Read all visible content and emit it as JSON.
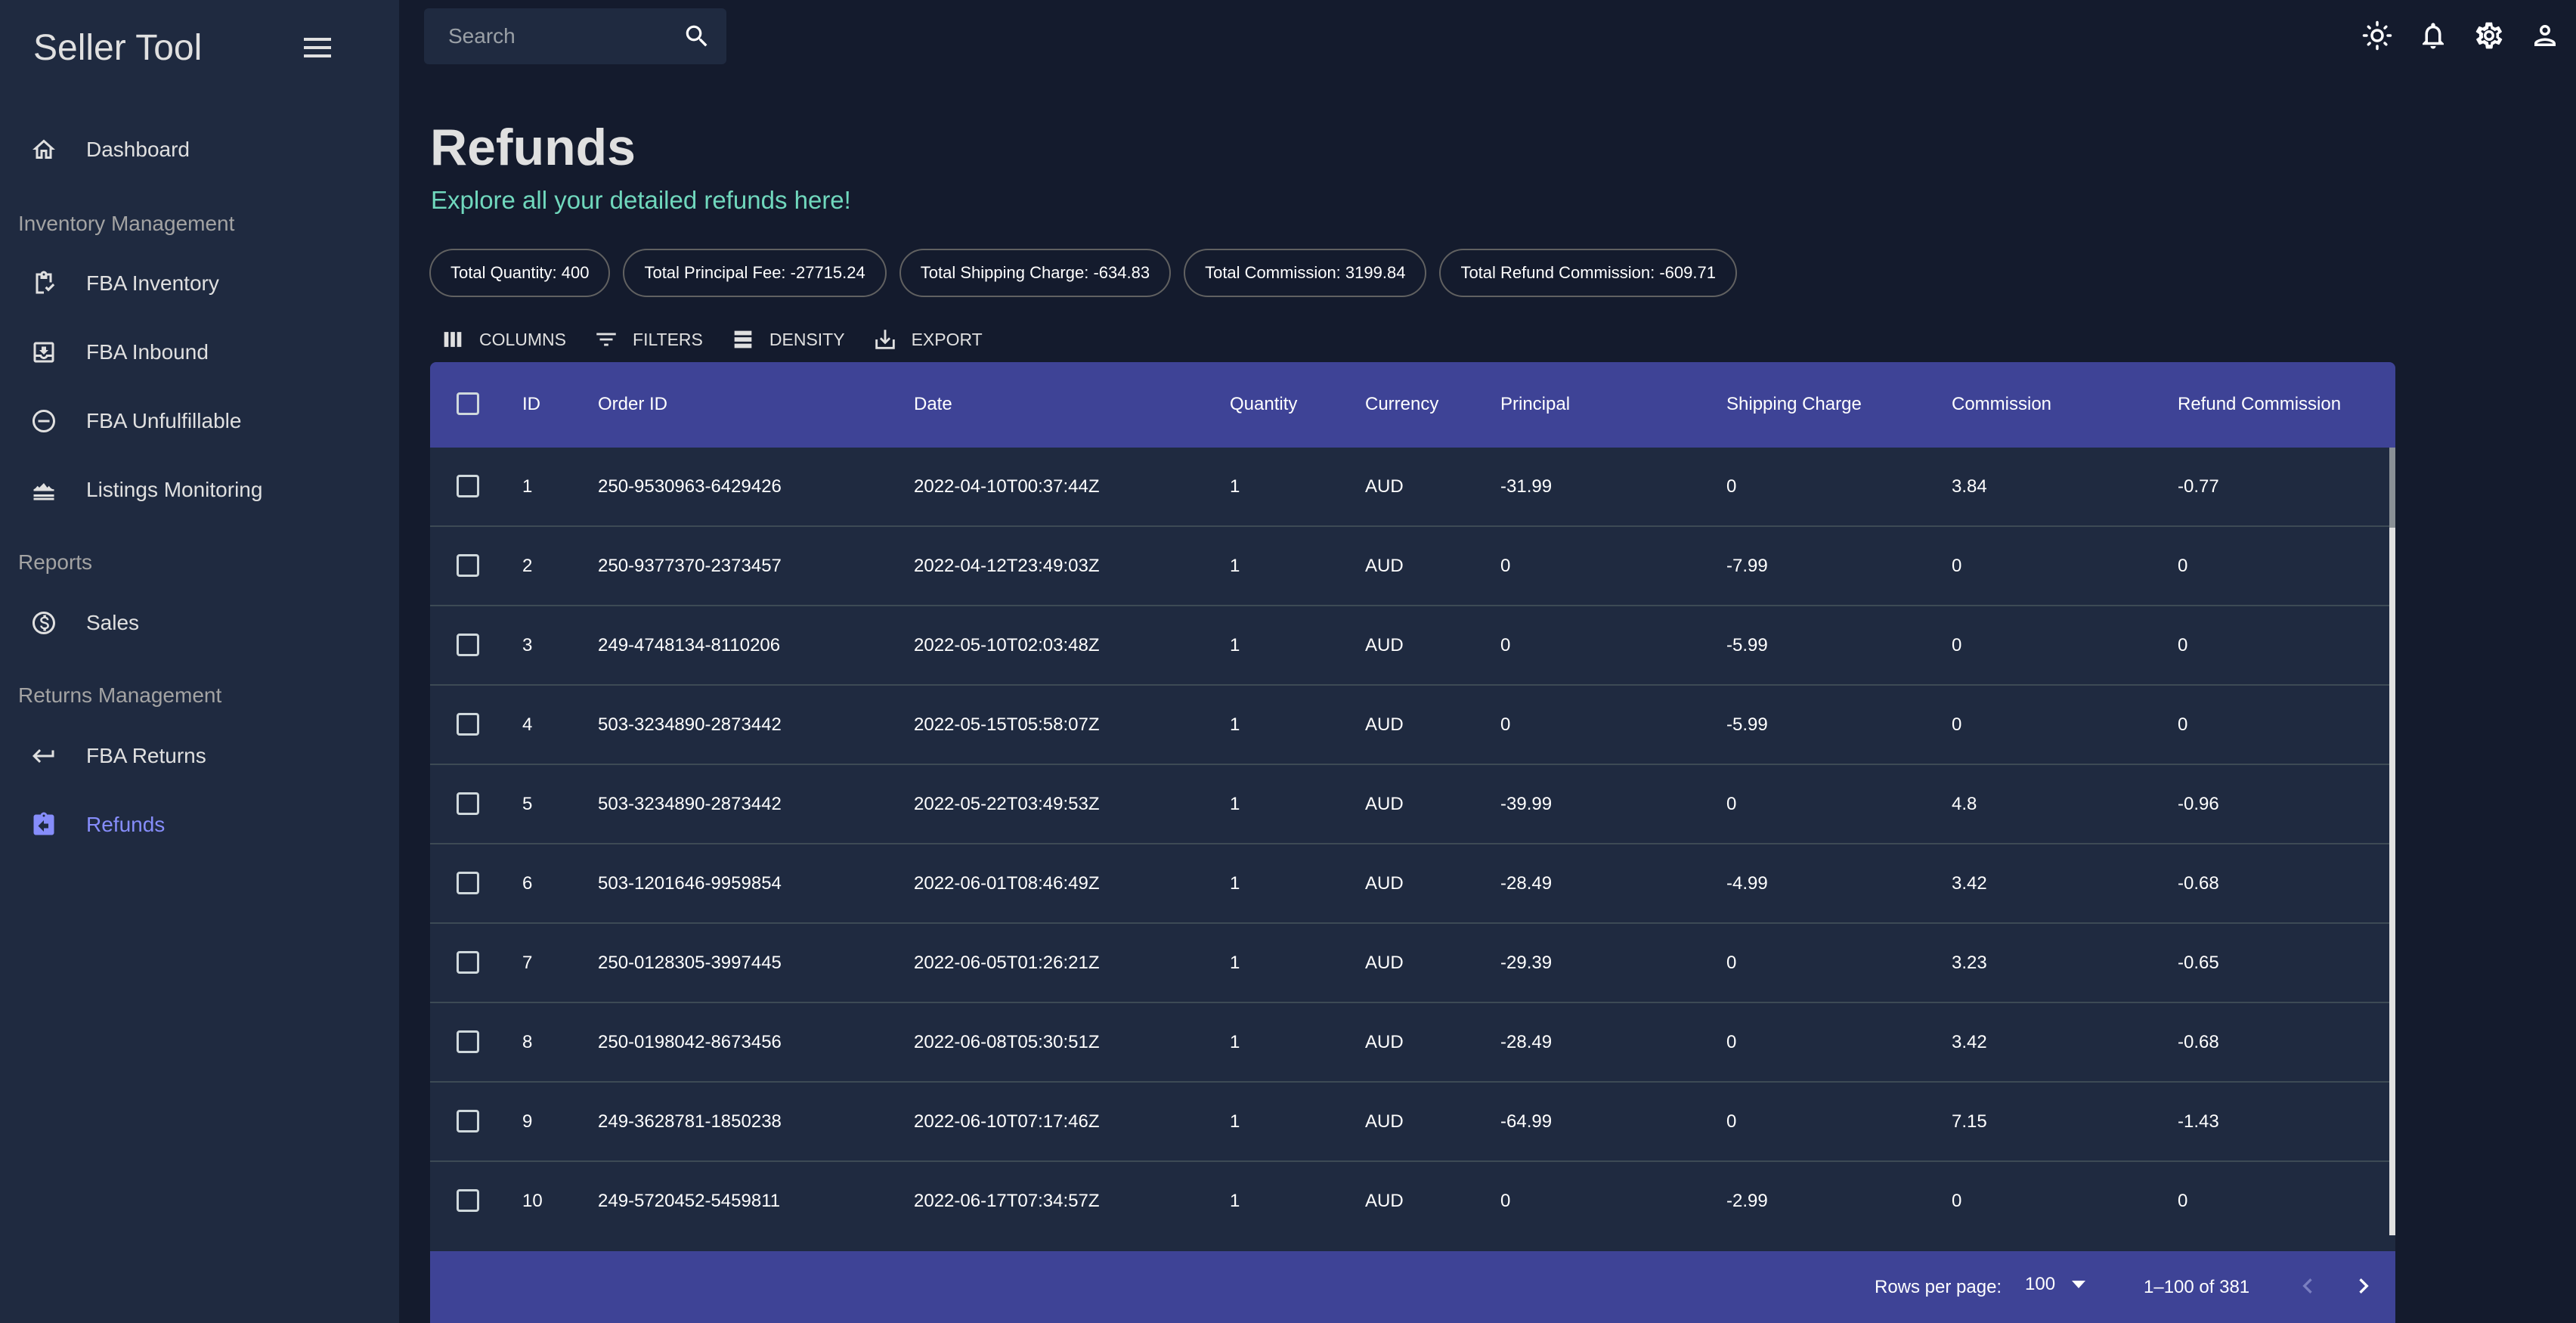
{
  "app": {
    "title": "Seller Tool"
  },
  "sidebar": {
    "sections": [
      {
        "label": "Inventory Management"
      },
      {
        "label": "Reports"
      },
      {
        "label": "Returns Management"
      }
    ],
    "items": [
      {
        "label": "Dashboard",
        "icon": "home-icon"
      },
      {
        "label": "FBA Inventory",
        "icon": "clipboard-check-icon"
      },
      {
        "label": "FBA Inbound",
        "icon": "inbox-download-icon"
      },
      {
        "label": "FBA Unfulfillable",
        "icon": "remove-circle-icon"
      },
      {
        "label": "Listings Monitoring",
        "icon": "waves-icon"
      },
      {
        "label": "Sales",
        "icon": "dollar-circle-icon"
      },
      {
        "label": "FBA Returns",
        "icon": "return-arrow-icon"
      },
      {
        "label": "Refunds",
        "icon": "assignment-return-icon",
        "active": true
      }
    ]
  },
  "topbar": {
    "search_placeholder": "Search",
    "icons": [
      "light-mode-icon",
      "notifications-icon",
      "settings-icon",
      "person-icon"
    ]
  },
  "header": {
    "title": "Refunds",
    "subtitle": "Explore all your detailed refunds here!"
  },
  "summary": [
    "Total Quantity: 400",
    "Total Principal Fee: -27715.24",
    "Total Shipping Charge: -634.83",
    "Total Commission: 3199.84",
    "Total Refund Commission: -609.71"
  ],
  "toolbar": {
    "columns": "COLUMNS",
    "filters": "FILTERS",
    "density": "DENSITY",
    "export": "EXPORT"
  },
  "table": {
    "columns": [
      "ID",
      "Order ID",
      "Date",
      "Quantity",
      "Currency",
      "Principal",
      "Shipping Charge",
      "Commission",
      "Refund Commission"
    ],
    "rows": [
      [
        "1",
        "250-9530963-6429426",
        "2022-04-10T00:37:44Z",
        "1",
        "AUD",
        "-31.99",
        "0",
        "3.84",
        "-0.77"
      ],
      [
        "2",
        "250-9377370-2373457",
        "2022-04-12T23:49:03Z",
        "1",
        "AUD",
        "0",
        "-7.99",
        "0",
        "0"
      ],
      [
        "3",
        "249-4748134-8110206",
        "2022-05-10T02:03:48Z",
        "1",
        "AUD",
        "0",
        "-5.99",
        "0",
        "0"
      ],
      [
        "4",
        "503-3234890-2873442",
        "2022-05-15T05:58:07Z",
        "1",
        "AUD",
        "0",
        "-5.99",
        "0",
        "0"
      ],
      [
        "5",
        "503-3234890-2873442",
        "2022-05-22T03:49:53Z",
        "1",
        "AUD",
        "-39.99",
        "0",
        "4.8",
        "-0.96"
      ],
      [
        "6",
        "503-1201646-9959854",
        "2022-06-01T08:46:49Z",
        "1",
        "AUD",
        "-28.49",
        "-4.99",
        "3.42",
        "-0.68"
      ],
      [
        "7",
        "250-0128305-3997445",
        "2022-06-05T01:26:21Z",
        "1",
        "AUD",
        "-29.39",
        "0",
        "3.23",
        "-0.65"
      ],
      [
        "8",
        "250-0198042-8673456",
        "2022-06-08T05:30:51Z",
        "1",
        "AUD",
        "-28.49",
        "0",
        "3.42",
        "-0.68"
      ],
      [
        "9",
        "249-3628781-1850238",
        "2022-06-10T07:17:46Z",
        "1",
        "AUD",
        "-64.99",
        "0",
        "7.15",
        "-1.43"
      ],
      [
        "10",
        "249-5720452-5459811",
        "2022-06-17T07:34:57Z",
        "1",
        "AUD",
        "0",
        "-2.99",
        "0",
        "0"
      ]
    ]
  },
  "pagination": {
    "rows_per_page_label": "Rows per page:",
    "rows_per_page_value": "100",
    "range": "1–100 of 381"
  },
  "colors": {
    "accent": "#3e4396",
    "active_nav": "#868dfb",
    "subtitle": "#70d8bd",
    "background": "#141b2d",
    "panel": "#1f2a40"
  }
}
